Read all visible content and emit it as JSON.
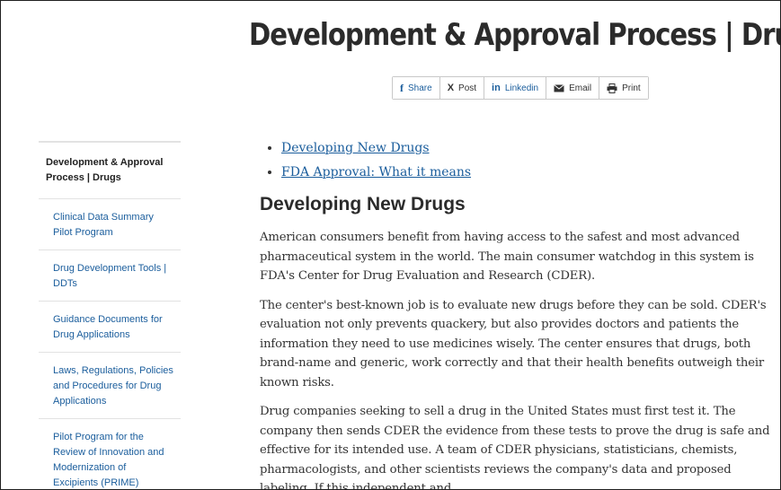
{
  "page": {
    "title": "Development & Approval Process | Drugs"
  },
  "share_bar": [
    {
      "label": "Share",
      "icon": "facebook-icon",
      "glyph": "f"
    },
    {
      "label": "Post",
      "icon": "x-icon",
      "glyph": "X"
    },
    {
      "label": "Linkedin",
      "icon": "linkedin-icon",
      "glyph": "in"
    },
    {
      "label": "Email",
      "icon": "email-icon",
      "glyph": "✉"
    },
    {
      "label": "Print",
      "icon": "print-icon",
      "glyph": "⎙"
    }
  ],
  "sidebar": {
    "current": "Development & Approval Process | Drugs",
    "items": [
      {
        "label": "Clinical Data Summary Pilot Program"
      },
      {
        "label": "Drug Development Tools | DDTs"
      },
      {
        "label": "Guidance Documents for Drug Applications"
      },
      {
        "label": "Laws, Regulations, Policies and Procedures for Drug Applications"
      },
      {
        "label": "Pilot Program for the Review of Innovation and Modernization of Excipients (PRIME)"
      }
    ]
  },
  "content": {
    "toc": [
      {
        "label": "Developing New Drugs"
      },
      {
        "label": "FDA Approval: What it means"
      }
    ],
    "section_heading": "Developing New Drugs",
    "paragraphs": [
      "American consumers benefit from having access to the safest and most advanced pharmaceutical system in the world. The main consumer watchdog in this system is FDA's Center for Drug Evaluation and Research (CDER).",
      "The center's best-known job is to evaluate new drugs before they can be sold. CDER's evaluation not only prevents quackery, but also provides doctors and patients the information they need to use medicines wisely. The center ensures that drugs, both brand-name and generic, work correctly and that their health benefits outweigh their known risks.",
      "Drug companies seeking to sell a drug in the United States must first test it. The company then sends CDER the evidence from these tests to prove the drug is safe and effective for its intended use. A team of CDER physicians, statisticians, chemists, pharmacologists, and other scientists reviews the company's data and proposed labeling. If this independent and"
    ]
  },
  "colors": {
    "link": "#1a5d9c",
    "heading": "#2b2b2b",
    "border": "#c8c8c8"
  }
}
